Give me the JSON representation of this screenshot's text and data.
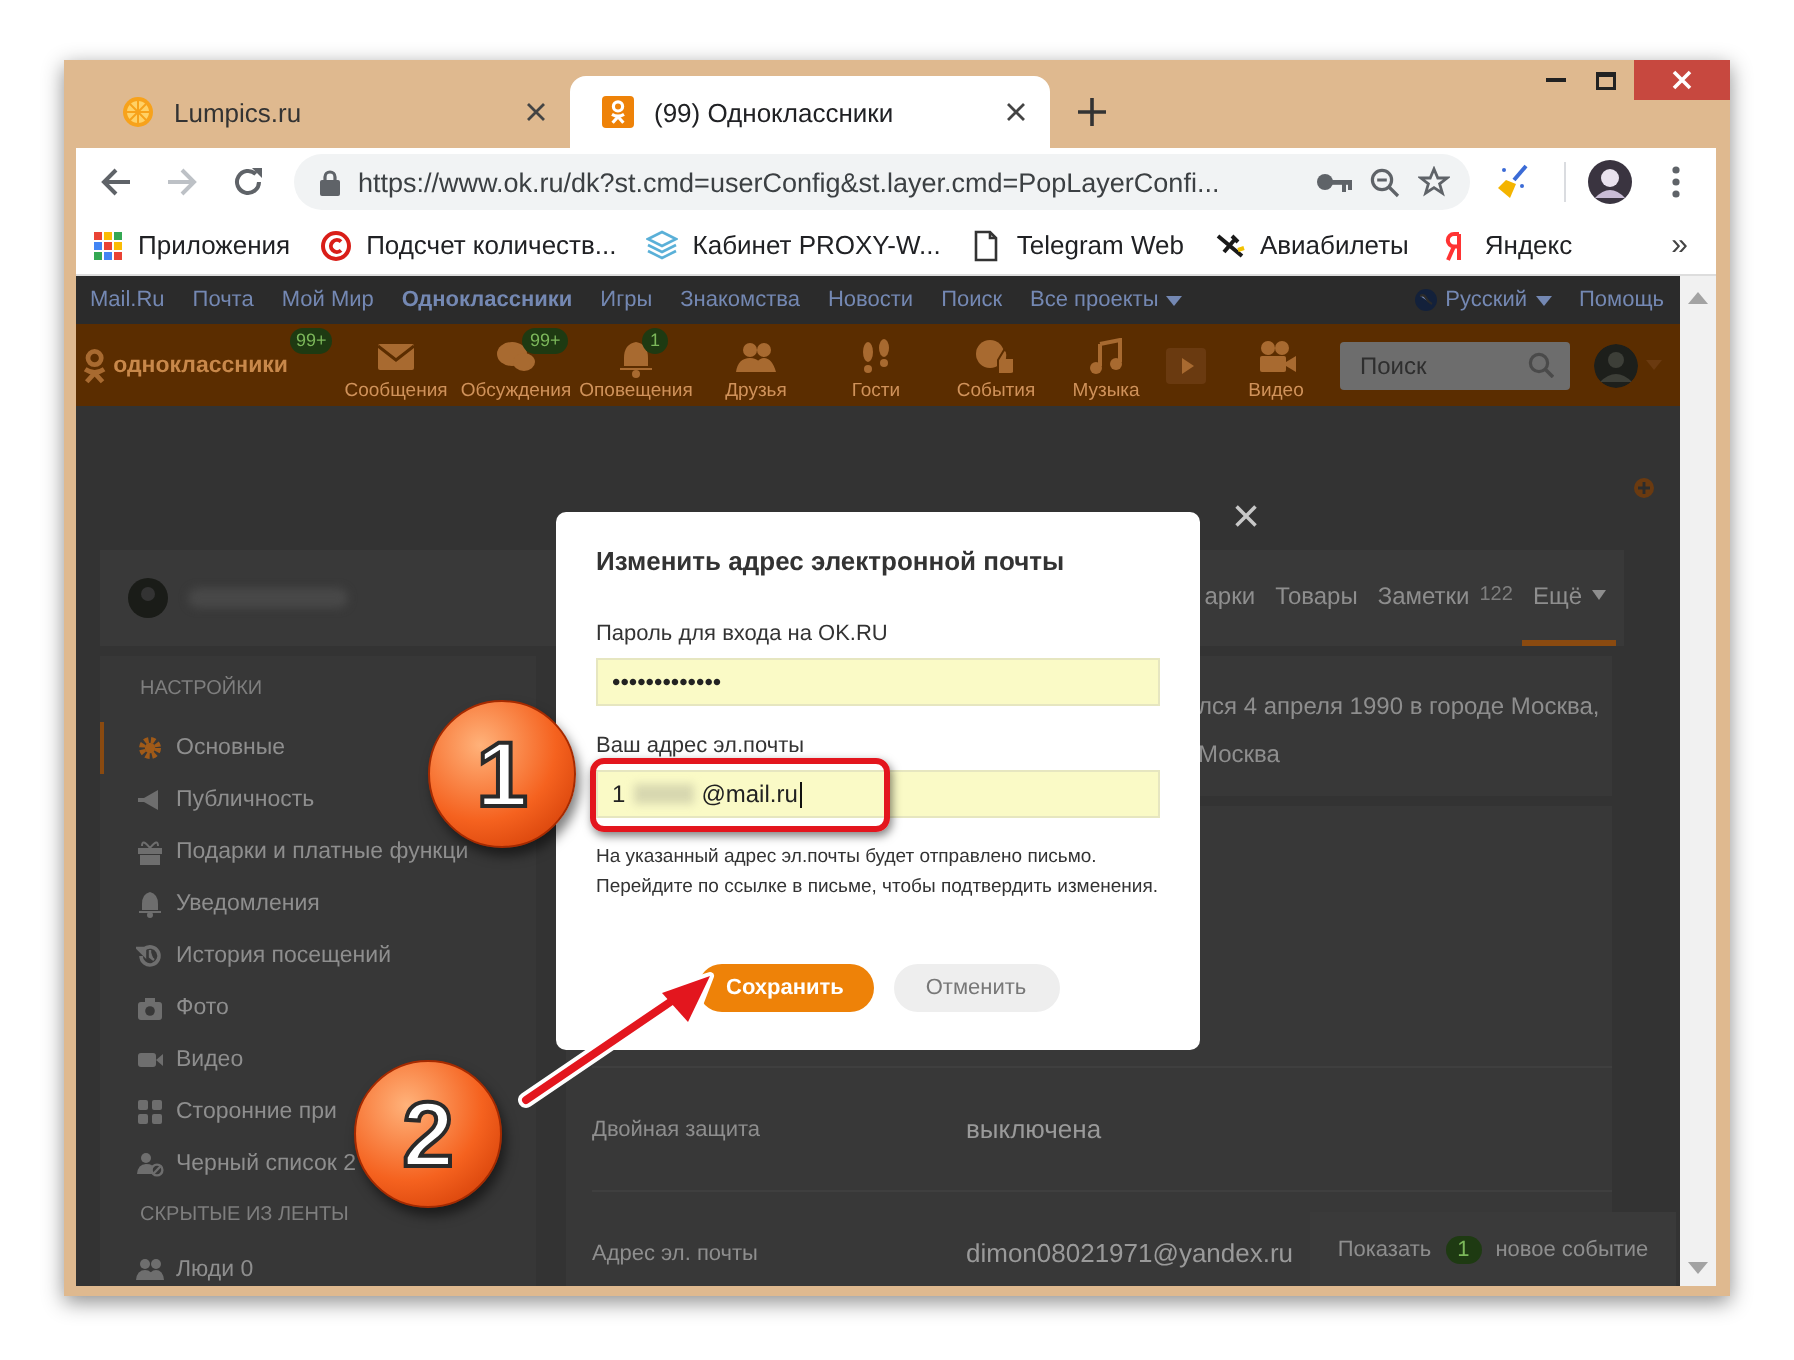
{
  "browser": {
    "tabs": [
      {
        "title": "Lumpics.ru",
        "selected": false
      },
      {
        "title": "(99) Одноклассники",
        "selected": true
      }
    ],
    "url": "https://www.ok.ru/dk?st.cmd=userConfig&st.layer.cmd=PopLayerConfi...",
    "bookmarks": [
      {
        "label": "Приложения"
      },
      {
        "label": "Подсчет количеств..."
      },
      {
        "label": "Кабинет PROXY-W..."
      },
      {
        "label": "Telegram Web"
      },
      {
        "label": "Авиабилеты"
      },
      {
        "label": "Яндекс"
      }
    ],
    "bookmarks_more": "»"
  },
  "mailru_bar": {
    "links": [
      {
        "label": "Mail.Ru",
        "selected": false
      },
      {
        "label": "Почта",
        "selected": false
      },
      {
        "label": "Мой Мир",
        "selected": false
      },
      {
        "label": "Одноклассники",
        "selected": true
      },
      {
        "label": "Игры",
        "selected": false
      },
      {
        "label": "Знакомства",
        "selected": false
      },
      {
        "label": "Новости",
        "selected": false
      },
      {
        "label": "Поиск",
        "selected": false
      },
      {
        "label": "Все проекты",
        "selected": false
      }
    ],
    "language": "Русский",
    "help": "Помощь"
  },
  "ok_bar": {
    "logo": "одноклассники",
    "logo_badge": "99+",
    "items": [
      {
        "label": "Сообщения"
      },
      {
        "label": "Обсуждения",
        "badge": "99+"
      },
      {
        "label": "Оповещения",
        "badge": "1"
      },
      {
        "label": "Друзья"
      },
      {
        "label": "Гости"
      },
      {
        "label": "События"
      },
      {
        "label": "Музыка"
      },
      {
        "label": "Видео"
      }
    ],
    "search_placeholder": "Поиск"
  },
  "profile_tabs": [
    {
      "label": "арки",
      "selected": false
    },
    {
      "label": "Товары",
      "selected": false
    },
    {
      "label": "Заметки",
      "count": "122",
      "selected": false
    },
    {
      "label": "Ещё",
      "selected": true
    }
  ],
  "sidebar": {
    "sections": [
      {
        "heading": "НАСТРОЙКИ",
        "items": [
          {
            "label": "Основные",
            "selected": true
          },
          {
            "label": "Публичность",
            "selected": false
          },
          {
            "label": "Подарки и платные функци",
            "selected": false
          },
          {
            "label": "Уведомления",
            "selected": false
          },
          {
            "label": "История посещений",
            "selected": false
          },
          {
            "label": "Фото",
            "selected": false
          },
          {
            "label": "Видео",
            "selected": false
          },
          {
            "label": "Сторонние при",
            "selected": false
          },
          {
            "label": "Черный список 2",
            "selected": false
          }
        ]
      },
      {
        "heading": "СКРЫТЫЕ ИЗ ЛЕНТЫ",
        "items": [
          {
            "label": "Люди 0",
            "selected": false
          }
        ]
      }
    ]
  },
  "profile_info": [
    "лся 4 апреля 1990 в городе Москва,",
    "Москва"
  ],
  "settings_rows": [
    {
      "label": "Двойная защита",
      "value": "выключена"
    },
    {
      "label": "Адрес эл. почты",
      "value": "dimon08021971@yandex.ru"
    }
  ],
  "toast": {
    "before": "Показать",
    "count": "1",
    "after": "новое событие"
  },
  "dialog": {
    "title": "Изменить адрес электронной почты",
    "password_label": "Пароль для входа на OK.RU",
    "password_value": "•••••••••••••",
    "email_label": "Ваш адрес эл.почты",
    "email_value_start": "1",
    "email_value_end": "@mail.ru",
    "hint": [
      "На указанный адрес эл.почты будет отправлено письмо.",
      "Перейдите по ссылке в письме, чтобы подтвердить изменения."
    ],
    "buttons": [
      {
        "label": "Сохранить",
        "kind": "primary"
      },
      {
        "label": "Отменить",
        "kind": "secondary"
      }
    ],
    "close": "×"
  },
  "annotations": {
    "callouts": [
      {
        "label": "1"
      },
      {
        "label": "2"
      }
    ]
  }
}
